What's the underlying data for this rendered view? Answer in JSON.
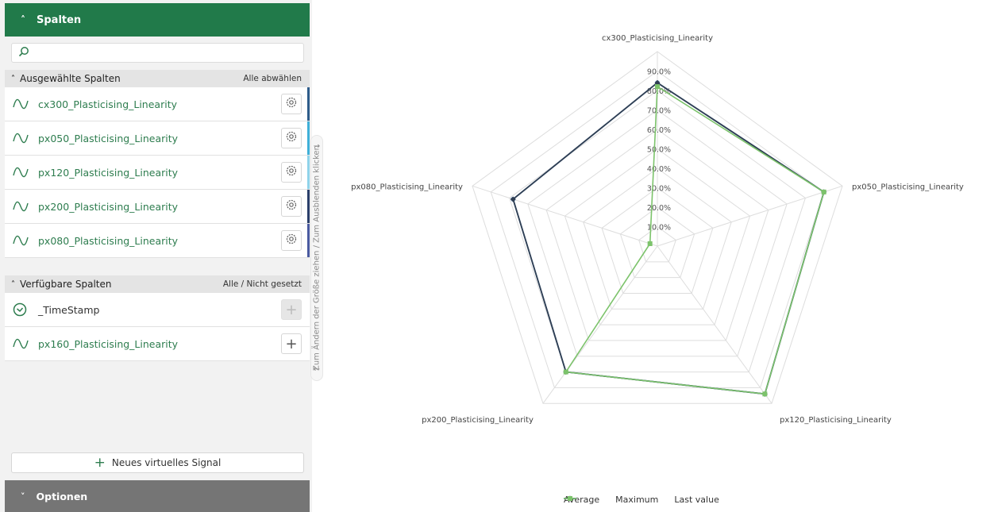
{
  "panel": {
    "header_label": "Spalten",
    "search_placeholder": "",
    "selected_section": {
      "title": "Ausgewählte Spalten",
      "action": "Alle abwählen",
      "items": [
        {
          "label": "cx300_Plasticising_Linearity",
          "color": "#2e5c8a"
        },
        {
          "label": "px050_Plasticising_Linearity",
          "color": "#3fb0d8"
        },
        {
          "label": "px120_Plasticising_Linearity",
          "color": "#8fd3ea"
        },
        {
          "label": "px200_Plasticising_Linearity",
          "color": "#2b3f6a"
        },
        {
          "label": "px080_Plasticising_Linearity",
          "color": "#4a5aa0"
        }
      ]
    },
    "available_section": {
      "title": "Verfügbare Spalten",
      "action": "Alle / Nicht gesetzt",
      "items": [
        {
          "label": "_TimeStamp",
          "icon": "clock-icon",
          "disabled": true
        },
        {
          "label": "px160_Plasticising_Linearity",
          "icon": "signal-wave-icon",
          "disabled": false
        }
      ]
    },
    "new_signal_label": "Neues virtuelles Signal",
    "options_label": "Optionen"
  },
  "splitter": {
    "text": "Zum Ändern der Größe ziehen / Zum Ausblenden klicken",
    "arrow_right": "→",
    "arrow_left": "←"
  },
  "colors": {
    "accent_green": "#217a4a",
    "grid": "#dddddd",
    "average": "#7aa6d8",
    "maximum": "#2f3e52",
    "last_value": "#7cc36b"
  },
  "chart_data": {
    "type": "radar",
    "axes": [
      "cx300_Plasticising_Linearity",
      "px050_Plasticising_Linearity",
      "px120_Plasticising_Linearity",
      "px200_Plasticising_Linearity",
      "px080_Plasticising_Linearity"
    ],
    "tick_labels": [
      "10.0%",
      "20.0%",
      "30.0%",
      "40.0%",
      "50.0%",
      "60.0%",
      "70.0%",
      "80.0%",
      "90.0%"
    ],
    "range": [
      0,
      100
    ],
    "series": [
      {
        "name": "Average",
        "values": [
          84,
          90,
          94,
          80,
          78
        ]
      },
      {
        "name": "Maximum",
        "values": [
          84,
          90,
          94,
          80,
          78
        ]
      },
      {
        "name": "Last value",
        "values": [
          82,
          90,
          94,
          80,
          4
        ]
      }
    ],
    "legend_position": "bottom-center"
  }
}
